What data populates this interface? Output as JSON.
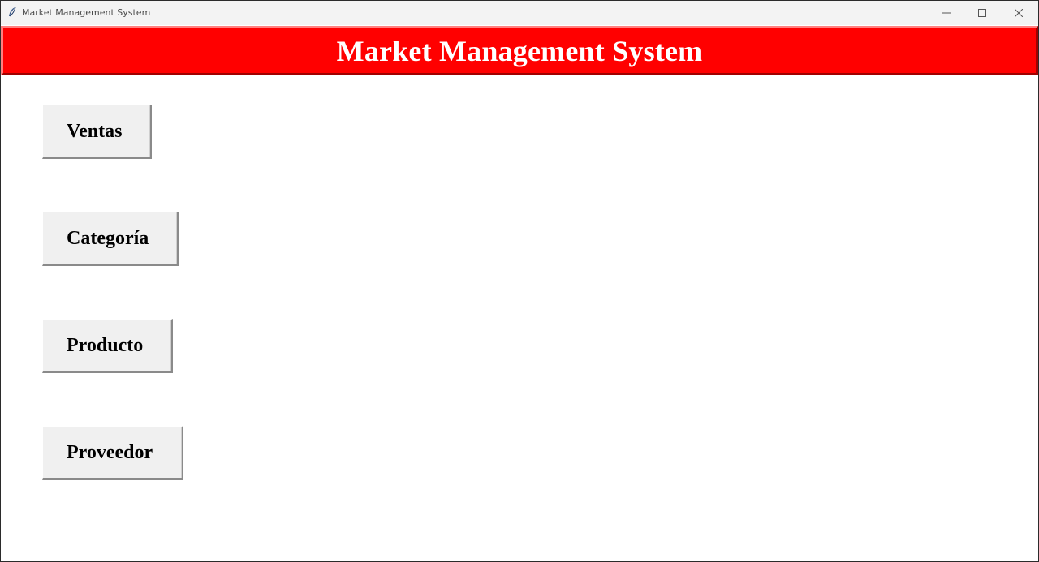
{
  "window": {
    "title": "Market Management System",
    "controls": {
      "minimize_icon": "minimize-icon",
      "maximize_icon": "maximize-icon",
      "close_icon": "close-icon"
    }
  },
  "banner": {
    "title": "Market Management System",
    "background": "#ff0000",
    "text_color": "#ffffff"
  },
  "menu": {
    "buttons": [
      {
        "label": "Ventas"
      },
      {
        "label": "Categoría"
      },
      {
        "label": "Producto"
      },
      {
        "label": "Proveedor"
      }
    ]
  }
}
